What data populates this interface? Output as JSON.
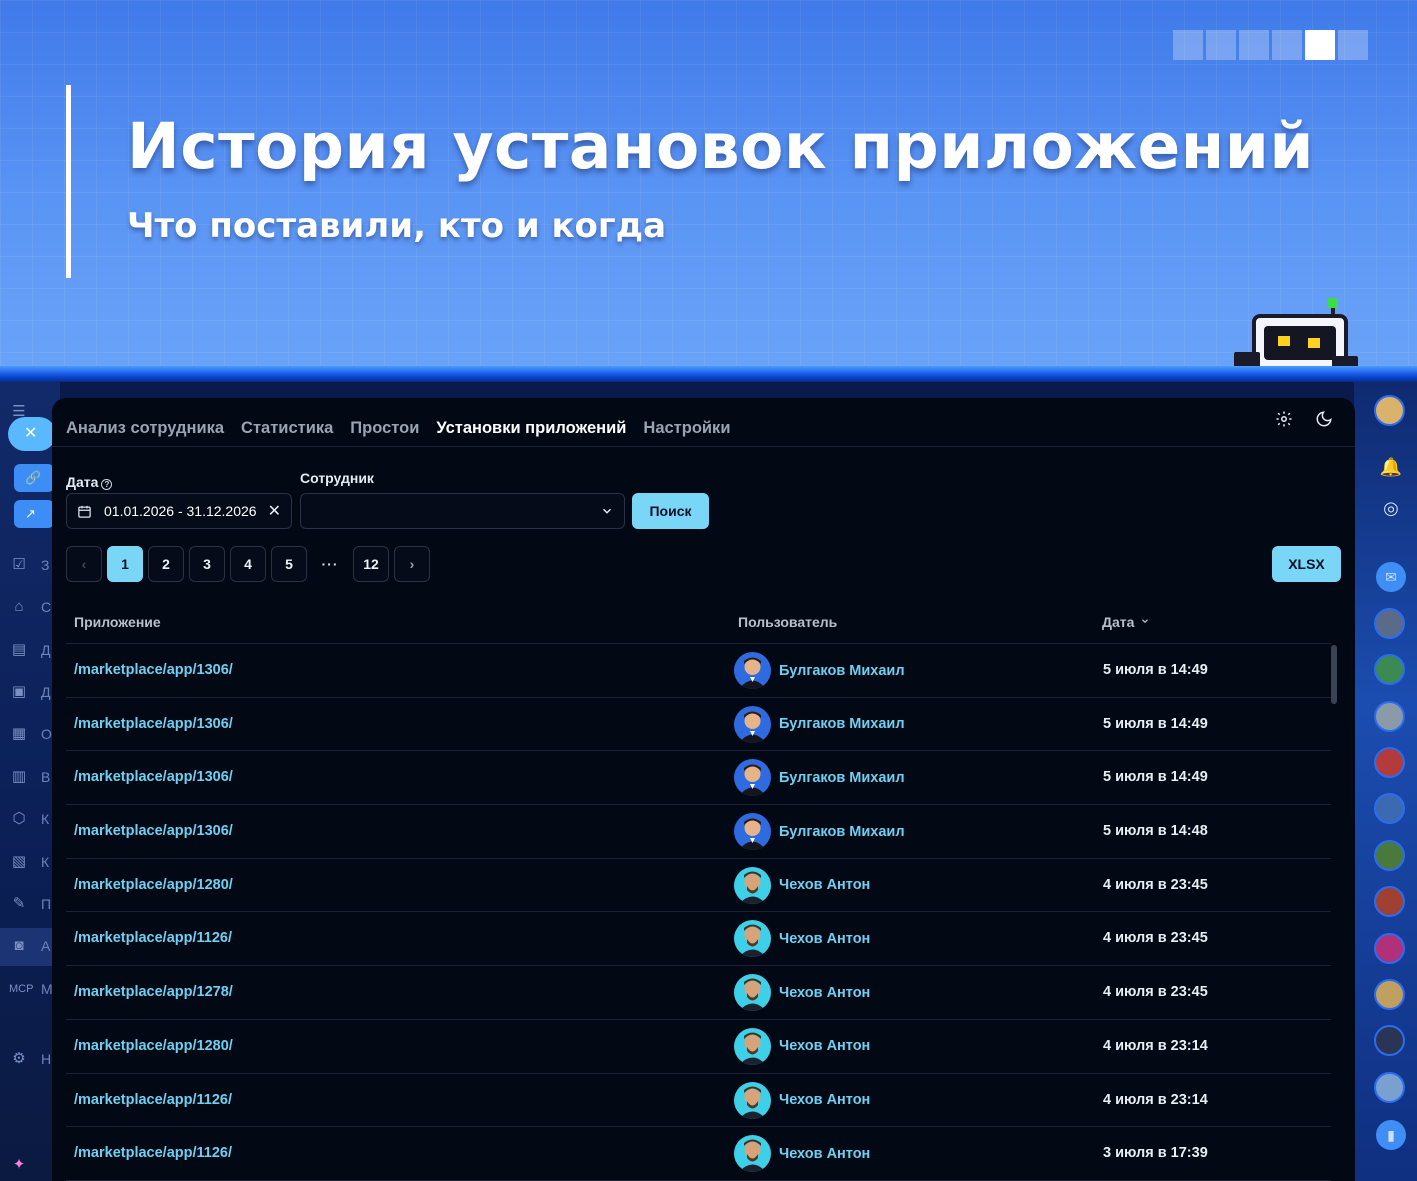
{
  "hero": {
    "title": "История установок приложений",
    "subtitle": "Что поставили, кто и когда"
  },
  "tabs": [
    {
      "label": "Анализ сотрудника"
    },
    {
      "label": "Статистика"
    },
    {
      "label": "Простои"
    },
    {
      "label": "Установки приложений",
      "active": true
    },
    {
      "label": "Настройки"
    }
  ],
  "filters": {
    "date_label": "Дата",
    "date_value": "01.01.2026 - 31.12.2026",
    "employee_label": "Сотрудник",
    "employee_value": "",
    "search_button": "Поиск"
  },
  "pagination": {
    "pages": [
      "1",
      "2",
      "3",
      "4",
      "5"
    ],
    "ellipsis": "···",
    "last_page": "12",
    "current": "1"
  },
  "export_button": "XLSX",
  "table": {
    "columns": {
      "app": "Приложение",
      "user": "Пользователь",
      "date": "Дата"
    },
    "rows": [
      {
        "app": "/marketplace/app/1306/",
        "user": "Булгаков Михаил",
        "date": "5 июля в 14:49",
        "avatar": "bulgakov"
      },
      {
        "app": "/marketplace/app/1306/",
        "user": "Булгаков Михаил",
        "date": "5 июля в 14:49",
        "avatar": "bulgakov"
      },
      {
        "app": "/marketplace/app/1306/",
        "user": "Булгаков Михаил",
        "date": "5 июля в 14:49",
        "avatar": "bulgakov"
      },
      {
        "app": "/marketplace/app/1306/",
        "user": "Булгаков Михаил",
        "date": "5 июля в 14:48",
        "avatar": "bulgakov"
      },
      {
        "app": "/marketplace/app/1280/",
        "user": "Чехов Антон",
        "date": "4 июля в 23:45",
        "avatar": "chekhov"
      },
      {
        "app": "/marketplace/app/1126/",
        "user": "Чехов Антон",
        "date": "4 июля в 23:45",
        "avatar": "chekhov"
      },
      {
        "app": "/marketplace/app/1278/",
        "user": "Чехов Антон",
        "date": "4 июля в 23:45",
        "avatar": "chekhov"
      },
      {
        "app": "/marketplace/app/1280/",
        "user": "Чехов Антон",
        "date": "4 июля в 23:14",
        "avatar": "chekhov"
      },
      {
        "app": "/marketplace/app/1126/",
        "user": "Чехов Антон",
        "date": "4 июля в 23:14",
        "avatar": "chekhov"
      },
      {
        "app": "/marketplace/app/1126/",
        "user": "Чехов Антон",
        "date": "3 июля в 17:39",
        "avatar": "chekhov"
      }
    ]
  },
  "left_rail": {
    "letters": [
      "З",
      "С",
      "Д",
      "Д",
      "О",
      "В",
      "К",
      "К",
      "П",
      "А",
      "М",
      "Н"
    ]
  },
  "colors": {
    "accent": "#7ad6f7",
    "link": "#6fd0f2",
    "panel_bg": "#020814",
    "hero_bg": "#4a86ee"
  }
}
